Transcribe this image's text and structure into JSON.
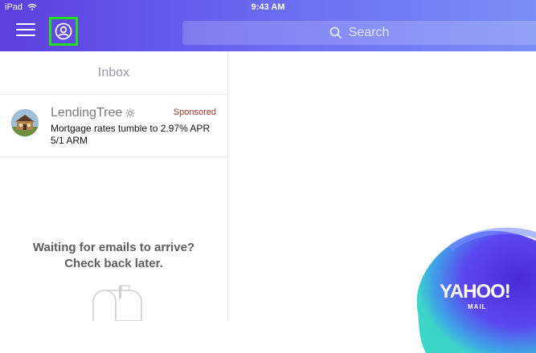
{
  "status_bar": {
    "device": "iPad",
    "time": "9:43 AM"
  },
  "header": {
    "menu_icon": "hamburger-menu-icon",
    "profile_icon": "user-circle-icon",
    "search_placeholder": "Search",
    "search_icon": "search-icon"
  },
  "inbox": {
    "title": "Inbox",
    "messages": [
      {
        "sender": "LendingTree",
        "sponsored_label": "Sponsored",
        "subject": "Mortgage rates tumble to 2.97% APR 5/1 ARM",
        "thumbnail": "house-thumbnail",
        "sender_badge_icon": "sun-icon"
      }
    ],
    "empty_message_line1": "Waiting for emails to arrive?",
    "empty_message_line2": "Check back later.",
    "empty_icon": "mailbox-icon"
  },
  "branding": {
    "logo_text": "YAHOO!",
    "logo_subtext": "MAIL"
  },
  "colors": {
    "header_gradient_start": "#5c3fe0",
    "header_gradient_end": "#7b8ef6",
    "highlight_border": "#22e020",
    "sponsored_red": "#a8322d"
  }
}
